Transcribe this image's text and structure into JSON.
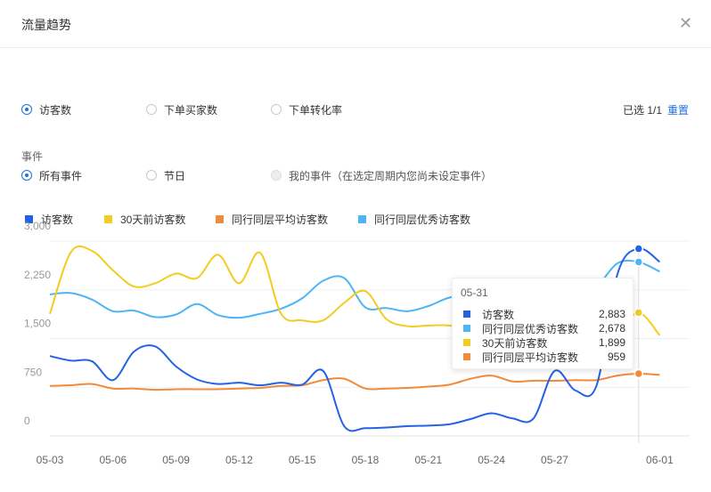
{
  "header": {
    "title": "流量趋势",
    "close_icon": "close-icon"
  },
  "metrics": {
    "options": [
      {
        "label": "访客数",
        "checked": true
      },
      {
        "label": "下单买家数",
        "checked": false
      },
      {
        "label": "下单转化率",
        "checked": false
      }
    ],
    "selected_text": "已选 1/1",
    "reset_label": "重置"
  },
  "events": {
    "title": "事件",
    "options": [
      {
        "label": "所有事件",
        "checked": true,
        "disabled": false
      },
      {
        "label": "节日",
        "checked": false,
        "disabled": false
      },
      {
        "label": "我的事件（在选定周期内您尚未设定事件）",
        "checked": false,
        "disabled": true
      }
    ]
  },
  "tooltip": {
    "date": "05-31",
    "rows": [
      {
        "name": "访客数",
        "value": "2,883",
        "color": "#2462e4"
      },
      {
        "name": "同行同层优秀访客数",
        "value": "2,678",
        "color": "#4db4f5"
      },
      {
        "name": "30天前访客数",
        "value": "1,899",
        "color": "#f2cc1f"
      },
      {
        "name": "同行同层平均访客数",
        "value": "959",
        "color": "#f18b3a"
      }
    ]
  },
  "chart_data": {
    "type": "line",
    "x_ticks": [
      "05-03",
      "05-06",
      "05-09",
      "05-12",
      "05-15",
      "05-18",
      "05-21",
      "05-24",
      "05-27",
      "06-01"
    ],
    "y_ticks": [
      "0",
      "750",
      "1,500",
      "2,250",
      "3,000"
    ],
    "ylim": [
      0,
      3000
    ],
    "categories": [
      "05-03",
      "05-04",
      "05-05",
      "05-06",
      "05-07",
      "05-08",
      "05-09",
      "05-10",
      "05-11",
      "05-12",
      "05-13",
      "05-14",
      "05-15",
      "05-16",
      "05-17",
      "05-18",
      "05-19",
      "05-20",
      "05-21",
      "05-22",
      "05-23",
      "05-24",
      "05-25",
      "05-26",
      "05-27",
      "05-28",
      "05-29",
      "05-30",
      "05-31",
      "06-01"
    ],
    "series": [
      {
        "name": "访客数",
        "color": "#2462e4",
        "values": [
          1230,
          1160,
          1150,
          860,
          1300,
          1380,
          1070,
          870,
          800,
          820,
          780,
          820,
          790,
          1000,
          150,
          120,
          130,
          150,
          160,
          180,
          260,
          350,
          270,
          270,
          1000,
          700,
          780,
          2500,
          2883,
          2680
        ]
      },
      {
        "name": "30天前访客数",
        "color": "#f2cc1f",
        "values": [
          1880,
          2830,
          2850,
          2550,
          2300,
          2350,
          2500,
          2430,
          2790,
          2350,
          2820,
          1880,
          1780,
          1780,
          2050,
          2230,
          1800,
          1690,
          1700,
          1700,
          1620,
          1600,
          1600,
          1590,
          1600,
          1600,
          1620,
          1600,
          1899,
          1550
        ]
      },
      {
        "name": "同行同层平均访客数",
        "color": "#f18b3a",
        "values": [
          770,
          780,
          800,
          730,
          730,
          710,
          720,
          720,
          720,
          730,
          740,
          770,
          780,
          860,
          880,
          730,
          730,
          740,
          760,
          790,
          880,
          930,
          840,
          850,
          850,
          860,
          860,
          930,
          959,
          940
        ]
      },
      {
        "name": "同行同层优秀访客数",
        "color": "#4db4f5",
        "values": [
          2180,
          2200,
          2100,
          1920,
          1930,
          1830,
          1870,
          2030,
          1860,
          1820,
          1880,
          1960,
          2120,
          2390,
          2430,
          1980,
          1970,
          1920,
          2000,
          2130,
          2160,
          2170,
          2220,
          2230,
          2230,
          2150,
          2300,
          2660,
          2678,
          2530
        ]
      }
    ],
    "highlight": {
      "category": "05-31"
    }
  }
}
